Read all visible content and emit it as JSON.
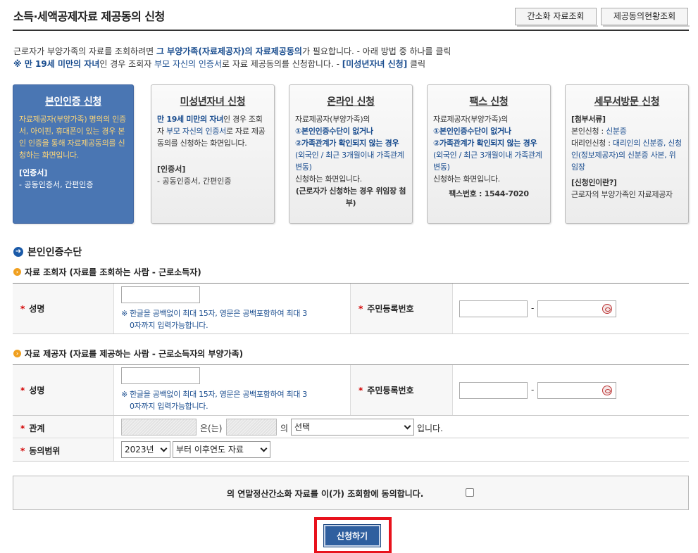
{
  "header": {
    "title": "소득·세액공제자료 제공동의 신청",
    "btn_simplified": "간소화 자료조회",
    "btn_status": "제공동의현황조회"
  },
  "intro": {
    "line1_a": "근로자가 부양가족의 자료를 조회하려면 ",
    "line1_b": "그 부양가족(자료제공자)의 자료제공동의",
    "line1_c": "가 필요합니다. - 아래 방법 중 하나를 클릭",
    "line2_a": "※ 만 19세 미만의 자녀",
    "line2_b": "인 경우 조회자 ",
    "line2_c": "부모 자신의 인증서",
    "line2_d": "로 자료 제공동의를 신청합니다. - ",
    "line2_e": "[미성년자녀 신청]",
    "line2_f": " 클릭"
  },
  "cards": {
    "self_auth": {
      "title": "본인인증 신청",
      "body": "자료제공자(부양가족) 명의의 인증서, 아이핀, 휴대폰이 있는 경우 본인 인증을 통해 자료제공동의를 신청하는 화면입니다.",
      "sub_title": "[인증서]",
      "sub_body": "- 공동인증서, 간편인증"
    },
    "minor": {
      "title": "미성년자녀 신청",
      "b1": "만 19세 미만의 자녀",
      "t1": "인 경우 조회자 ",
      "n1": "부모 자신의 인증서",
      "t2": "로 자료 제공 동의를 신청하는 화면입니다.",
      "sub_title": "[인증서]",
      "sub_body": "- 공동인증서, 간편인증"
    },
    "online": {
      "title": "온라인 신청",
      "t1": "자료제공자(부양가족)의",
      "b1": "①본인인증수단이 없거나",
      "b2": "②가족관계가 확인되지 않는 경우",
      "n1": "(외국인 / 최근 3개월이내 가족관계 변동)",
      "t2": "신청하는 화면입니다.",
      "k1": "(근로자가 신청하는 경우 위임장 첨부)"
    },
    "fax": {
      "title": "팩스 신청",
      "t1": "자료제공자(부양가족)의",
      "b1": "①본인인증수단이 없거나",
      "b2": "②가족관계가 확인되지 않는 경우",
      "n1": "(외국인 / 최근 3개월이내 가족관계 변동)",
      "t2": "신청하는 화면입니다.",
      "k1": "팩스번호 : 1544-7020"
    },
    "visit": {
      "title": "세무서방문 신청",
      "k1": "[첨부서류]",
      "t1": "본인신청 : ",
      "n1": "신분증",
      "t2": "대리인신청 : ",
      "n2": "대리인의 신분증, 신청인(정보제공자)의 신분증 사본, 위임장",
      "k2": "[신청인이란?]",
      "t3": "근로자의 부양가족인 자료제공자"
    }
  },
  "form": {
    "section_title": "본인인증수단",
    "requester_title": "자료 조회자 (자료를 조회하는 사람 - 근로소득자)",
    "provider_title": "자료 제공자 (자료를 제공하는 사람 - 근로소득자의 부양가족)",
    "name_label": "성명",
    "rrn_label": "주민등록번호",
    "relation_label": "관계",
    "scope_label": "동의범위",
    "name_note_1": "※ 한글을 공백없이 최대 15자, 영문은 공백포함하여 최대 3",
    "name_note_2": "0자까지 입력가능합니다.",
    "dash": "-",
    "star": "*",
    "relation_eun": "은(는)",
    "relation_ui": "의",
    "relation_select": "선택",
    "relation_end": "입니다.",
    "year_select": "2023년",
    "scope_select": "부터 이후연도 자료"
  },
  "agree": {
    "text": "의 연말정산간소화 자료를 이(가) 조회함에 동의합니다."
  },
  "submit": {
    "label": "신청하기"
  }
}
